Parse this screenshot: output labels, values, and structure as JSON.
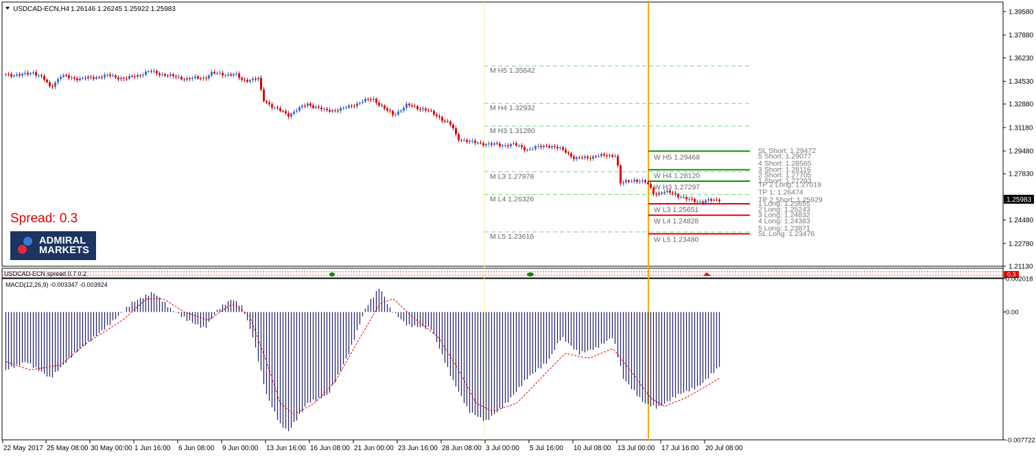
{
  "header": {
    "symbol_timeframe": "USDCAD-ECN,H4",
    "ohlc": "1.26146 1.26245 1.25922 1.25983"
  },
  "spread": {
    "label": "Spread:",
    "value": "0.3"
  },
  "logo": {
    "line1": "ADMIRAL",
    "line2": "MARKETS"
  },
  "spread_indicator": {
    "label": "USDCAD-ECN spread 0.7 0.2",
    "badge": "0.3"
  },
  "macd": {
    "label": "MACD(12,26,9) -0.003347 -0.003924"
  },
  "colors": {
    "bull": "#3a6fd8",
    "bear": "#e00000",
    "price_badge": "#000000",
    "vline_current": "#ffa500",
    "vline_week": "#ffe9a8",
    "monthly_pivot_line": "#7fd17f",
    "weekly_green": "#009900",
    "weekly_red": "#e00000",
    "macd_hist": "#1a1a6e",
    "macd_signal": "#e00000"
  },
  "chart_data": [
    {
      "type": "candlestick",
      "title": "USDCAD-ECN,H4",
      "ylim": [
        1.2113,
        1.4027
      ],
      "y_ticks": [
        "1.39580",
        "1.37880",
        "1.36230",
        "1.34530",
        "1.32880",
        "1.31180",
        "1.29480",
        "1.27830",
        "1.26130",
        "1.24480",
        "1.22780",
        "1.21130"
      ],
      "current_price": "1.25983",
      "x_tick_labels": [
        "22 May 2017",
        "25 May 08:00",
        "30 May 00:00",
        "1 Jun 16:00",
        "6 Jun 08:00",
        "9 Jun 00:00",
        "13 Jun 16:00",
        "16 Jun 08:00",
        "21 Jun 00:00",
        "23 Jun 16:00",
        "28 Jun 08:00",
        "3 Jul 00:00",
        "5 Jul 16:00",
        "10 Jul 08:00",
        "13 Jul 00:00",
        "17 Jul 16:00",
        "20 Jul 08:00"
      ],
      "close_path": [
        {
          "t": 0,
          "v": 1.3505
        },
        {
          "t": 20,
          "v": 1.3495
        },
        {
          "t": 40,
          "v": 1.352
        },
        {
          "t": 55,
          "v": 1.347
        },
        {
          "t": 65,
          "v": 1.341
        },
        {
          "t": 80,
          "v": 1.349
        },
        {
          "t": 110,
          "v": 1.347
        },
        {
          "t": 150,
          "v": 1.3495
        },
        {
          "t": 175,
          "v": 1.347
        },
        {
          "t": 210,
          "v": 1.3525
        },
        {
          "t": 240,
          "v": 1.349
        },
        {
          "t": 265,
          "v": 1.347
        },
        {
          "t": 290,
          "v": 1.348
        },
        {
          "t": 300,
          "v": 1.351
        },
        {
          "t": 335,
          "v": 1.35
        },
        {
          "t": 345,
          "v": 1.346
        },
        {
          "t": 368,
          "v": 1.347
        },
        {
          "t": 375,
          "v": 1.332
        },
        {
          "t": 395,
          "v": 1.325
        },
        {
          "t": 412,
          "v": 1.321
        },
        {
          "t": 440,
          "v": 1.329
        },
        {
          "t": 465,
          "v": 1.324
        },
        {
          "t": 490,
          "v": 1.325
        },
        {
          "t": 505,
          "v": 1.328
        },
        {
          "t": 535,
          "v": 1.333
        },
        {
          "t": 550,
          "v": 1.326
        },
        {
          "t": 565,
          "v": 1.321
        },
        {
          "t": 585,
          "v": 1.328
        },
        {
          "t": 610,
          "v": 1.325
        },
        {
          "t": 630,
          "v": 1.32
        },
        {
          "t": 650,
          "v": 1.313
        },
        {
          "t": 658,
          "v": 1.304
        },
        {
          "t": 680,
          "v": 1.301
        },
        {
          "t": 720,
          "v": 1.299
        },
        {
          "t": 740,
          "v": 1.2995
        },
        {
          "t": 760,
          "v": 1.296
        },
        {
          "t": 790,
          "v": 1.299
        },
        {
          "t": 815,
          "v": 1.295
        },
        {
          "t": 830,
          "v": 1.289
        },
        {
          "t": 860,
          "v": 1.291
        },
        {
          "t": 890,
          "v": 1.292
        },
        {
          "t": 895,
          "v": 1.271
        },
        {
          "t": 915,
          "v": 1.274
        },
        {
          "t": 935,
          "v": 1.2715
        },
        {
          "t": 945,
          "v": 1.264
        },
        {
          "t": 970,
          "v": 1.265
        },
        {
          "t": 990,
          "v": 1.26
        },
        {
          "t": 1015,
          "v": 1.258
        },
        {
          "t": 1040,
          "v": 1.2598
        }
      ],
      "monthly_pivots": [
        {
          "label": "M  H5 1.35642",
          "value": 1.35642
        },
        {
          "label": "M  H4 1.32932",
          "value": 1.32932
        },
        {
          "label": "M  H3 1.31280",
          "value": 1.3128
        },
        {
          "label": "M  L3 1.27978",
          "value": 1.27978
        },
        {
          "label": "M  L4 1.26326",
          "value": 1.26326
        },
        {
          "label": "M  L5 1.23616",
          "value": 1.23616
        }
      ],
      "weekly_pivots": [
        {
          "label": "W  H5 1.29468",
          "value": 1.29468,
          "color": "green"
        },
        {
          "label": "W  H4 1.28120",
          "value": 1.2812,
          "color": "green"
        },
        {
          "label": "W  H3 1.27297",
          "value": 1.27297,
          "color": "green"
        },
        {
          "label": "W  L3 1.25651",
          "value": 1.25651,
          "color": "red"
        },
        {
          "label": "W  L4 1.24828",
          "value": 1.24828,
          "color": "red"
        },
        {
          "label": "W  L5 1.23480",
          "value": 1.2348,
          "color": "red"
        }
      ],
      "targets": [
        {
          "label": "SL Short: 1.29472",
          "value": 1.29472
        },
        {
          "label": "5 Short: 1.29077",
          "value": 1.29077
        },
        {
          "label": "4 Short: 1.28565",
          "value": 1.28565
        },
        {
          "label": "3 Short: 1.28116",
          "value": 1.28116
        },
        {
          "label": "2 Short: 1.27705",
          "value": 1.27705
        },
        {
          "label": "1 Short: 1.27293",
          "value": 1.27293
        },
        {
          "label": "TP 2 Long: 1.27019",
          "value": 1.27019
        },
        {
          "label": "TP 1: 1.26474",
          "value": 1.26474
        },
        {
          "label": "TP 2 Short: 1.25929",
          "value": 1.25929
        },
        {
          "label": "1 Long: 1.25655",
          "value": 1.25655
        },
        {
          "label": "2 Long: 1.25243",
          "value": 1.25243
        },
        {
          "label": "3 Long: 1.24832",
          "value": 1.24832
        },
        {
          "label": "4 Long: 1.24383",
          "value": 1.24383
        },
        {
          "label": "5 Long: 1.23871",
          "value": 1.23871
        },
        {
          "label": "SL Long: 1.23476",
          "value": 1.23476
        }
      ]
    },
    {
      "type": "bar",
      "title": "MACD(12,26,9) -0.003347 -0.003924",
      "ylim": [
        -0.007722,
        0.002018
      ],
      "y_ticks": [
        "0.002018",
        "0.00",
        "-0.007722"
      ],
      "series": [
        {
          "name": "MACD",
          "values": [
            {
              "t": 0,
              "v": -0.0035
            },
            {
              "t": 30,
              "v": -0.003
            },
            {
              "t": 65,
              "v": -0.004
            },
            {
              "t": 100,
              "v": -0.0025
            },
            {
              "t": 150,
              "v": -0.0008
            },
            {
              "t": 185,
              "v": 0.0006
            },
            {
              "t": 215,
              "v": 0.0012
            },
            {
              "t": 240,
              "v": 0.0002
            },
            {
              "t": 265,
              "v": -0.0005
            },
            {
              "t": 290,
              "v": -0.001
            },
            {
              "t": 310,
              "v": 0.0002
            },
            {
              "t": 330,
              "v": 0.0008
            },
            {
              "t": 345,
              "v": 0.0003
            },
            {
              "t": 360,
              "v": -0.0015
            },
            {
              "t": 380,
              "v": -0.005
            },
            {
              "t": 400,
              "v": -0.0068
            },
            {
              "t": 412,
              "v": -0.0072
            },
            {
              "t": 440,
              "v": -0.0055
            },
            {
              "t": 470,
              "v": -0.005
            },
            {
              "t": 500,
              "v": -0.0025
            },
            {
              "t": 525,
              "v": 0.0003
            },
            {
              "t": 545,
              "v": 0.0015
            },
            {
              "t": 560,
              "v": 0.0002
            },
            {
              "t": 585,
              "v": -0.0008
            },
            {
              "t": 620,
              "v": -0.001
            },
            {
              "t": 650,
              "v": -0.004
            },
            {
              "t": 675,
              "v": -0.006
            },
            {
              "t": 700,
              "v": -0.0066
            },
            {
              "t": 730,
              "v": -0.0055
            },
            {
              "t": 760,
              "v": -0.004
            },
            {
              "t": 790,
              "v": -0.003
            },
            {
              "t": 810,
              "v": -0.0015
            },
            {
              "t": 835,
              "v": -0.0025
            },
            {
              "t": 860,
              "v": -0.0022
            },
            {
              "t": 885,
              "v": -0.0015
            },
            {
              "t": 900,
              "v": -0.004
            },
            {
              "t": 930,
              "v": -0.0055
            },
            {
              "t": 950,
              "v": -0.0058
            },
            {
              "t": 980,
              "v": -0.005
            },
            {
              "t": 1010,
              "v": -0.0045
            },
            {
              "t": 1040,
              "v": -0.0033
            }
          ]
        },
        {
          "name": "Signal",
          "values": [
            {
              "t": 0,
              "v": -0.003
            },
            {
              "t": 35,
              "v": -0.0035
            },
            {
              "t": 80,
              "v": -0.0032
            },
            {
              "t": 120,
              "v": -0.0018
            },
            {
              "t": 170,
              "v": -0.0005
            },
            {
              "t": 205,
              "v": 0.0008
            },
            {
              "t": 230,
              "v": 0.0008
            },
            {
              "t": 260,
              "v": 0.0
            },
            {
              "t": 295,
              "v": -0.0005
            },
            {
              "t": 330,
              "v": 0.0005
            },
            {
              "t": 355,
              "v": -0.0002
            },
            {
              "t": 380,
              "v": -0.003
            },
            {
              "t": 400,
              "v": -0.0055
            },
            {
              "t": 420,
              "v": -0.0062
            },
            {
              "t": 450,
              "v": -0.0055
            },
            {
              "t": 480,
              "v": -0.0042
            },
            {
              "t": 510,
              "v": -0.002
            },
            {
              "t": 545,
              "v": 0.0005
            },
            {
              "t": 565,
              "v": 0.0008
            },
            {
              "t": 590,
              "v": -0.0002
            },
            {
              "t": 630,
              "v": -0.0015
            },
            {
              "t": 660,
              "v": -0.0035
            },
            {
              "t": 685,
              "v": -0.0055
            },
            {
              "t": 710,
              "v": -0.006
            },
            {
              "t": 745,
              "v": -0.0055
            },
            {
              "t": 780,
              "v": -0.004
            },
            {
              "t": 815,
              "v": -0.0025
            },
            {
              "t": 850,
              "v": -0.0028
            },
            {
              "t": 885,
              "v": -0.0022
            },
            {
              "t": 910,
              "v": -0.0035
            },
            {
              "t": 940,
              "v": -0.0052
            },
            {
              "t": 960,
              "v": -0.0057
            },
            {
              "t": 990,
              "v": -0.0052
            },
            {
              "t": 1020,
              "v": -0.0045
            },
            {
              "t": 1040,
              "v": -0.004
            }
          ]
        }
      ]
    }
  ]
}
